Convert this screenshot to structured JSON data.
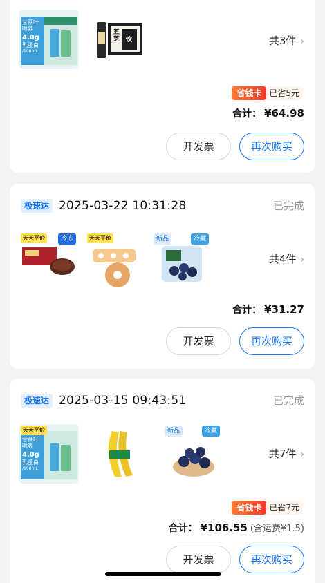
{
  "orders": [
    {
      "count_text": "共3件",
      "saver_badge": "省钱卡",
      "saver_text": "已省5元",
      "total_label": "合计：",
      "total_amount": "¥64.98",
      "invoice_label": "开发票",
      "rebuy_label": "再次购买",
      "thumb_labels": [
        "甘蔗叶",
        "嗯养",
        "4.0g",
        "乳蛋白",
        "/100mL",
        "五",
        "芝",
        "饮"
      ]
    },
    {
      "delivery_badge": "极速达",
      "time": "2025-03-22 10:31:28",
      "status": "已完成",
      "count_text": "共4件",
      "total_label": "合计：",
      "total_amount": "¥31.27",
      "invoice_label": "开发票",
      "rebuy_label": "再次购买",
      "tags": {
        "promo": "天天平价",
        "frozen": "冷冻",
        "new": "新品",
        "chill": "冷藏"
      }
    },
    {
      "delivery_badge": "极速达",
      "time": "2025-03-15 09:43:51",
      "status": "已完成",
      "count_text": "共7件",
      "saver_badge": "省钱卡",
      "saver_text": "已省7元",
      "total_label": "合计：",
      "total_amount": "¥106.55",
      "shipping_note": "(含运费¥1.5)",
      "invoice_label": "开发票",
      "rebuy_label": "再次购买",
      "tags": {
        "promo": "天天平价",
        "new": "新品",
        "chill": "冷藏"
      },
      "thumb_labels": [
        "甘蔗叶",
        "嗯养",
        "4.0g",
        "乳蛋白",
        "/100mL"
      ]
    }
  ],
  "chevron": "›",
  "colors": {
    "accent": "#1677ff",
    "saver_start": "#ff7a2e",
    "saver_end": "#f23a2b"
  }
}
